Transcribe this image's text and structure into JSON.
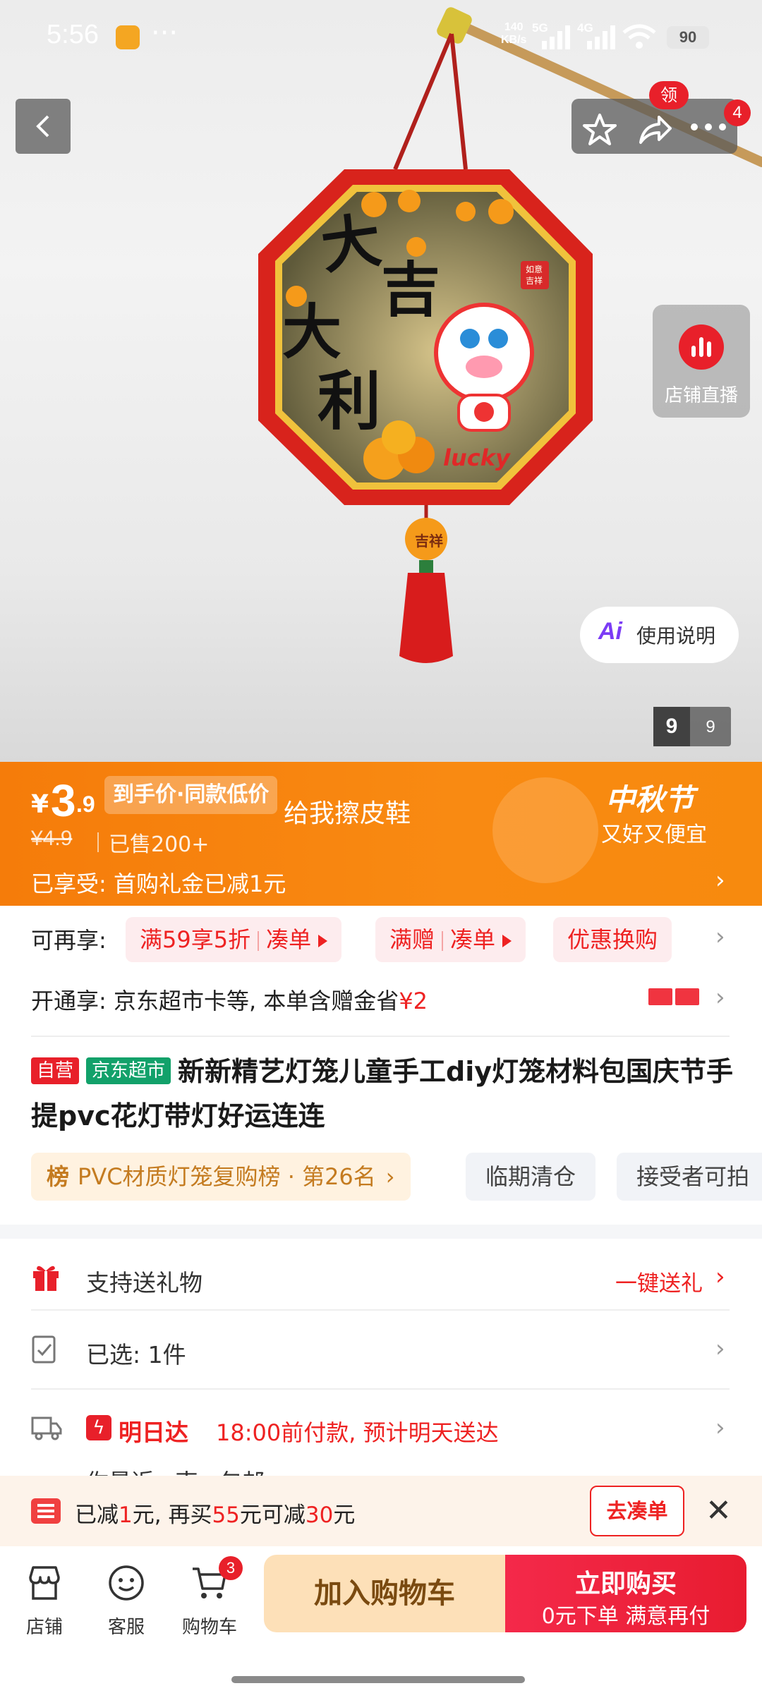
{
  "status_bar": {
    "time": "5:56",
    "more": "···",
    "net_speed_top": "140",
    "net_speed_bottom": "KB/s",
    "signal_1": "5G",
    "signal_2": "4G",
    "battery": "90"
  },
  "top_nav": {
    "coupon_badge": "领",
    "msg_count": "4"
  },
  "product_image": {
    "calligraphy": "大吉大利",
    "charm_text": "吉祥",
    "lucky_text": "lucky",
    "stamp_text": "如意吉祥"
  },
  "side": {
    "live_label": "店铺直播",
    "ai_label": "Ai",
    "guide_label": "使用说明"
  },
  "gallery": {
    "current": "9",
    "total": "9"
  },
  "price": {
    "currency": "¥",
    "integer": "3",
    "decimal": ".9",
    "tag": "到手价·同款低价",
    "overlay_text": "给我擦皮鞋",
    "original": "¥4.9",
    "sold": "已售200+",
    "enjoyed": "已享受: 首购礼金已减1元",
    "festival_title": "中秋节",
    "festival_sub": "又好又便宜"
  },
  "promo": {
    "label": "可再享:",
    "chip1_main": "满59享5折",
    "chip1_action": "凑单",
    "chip2_main": "满赠",
    "chip2_action": "凑单",
    "chip3": "优惠换购"
  },
  "member": {
    "text_prefix": "开通享: 京东超市卡等, 本单含赠金省",
    "amount": "¥2"
  },
  "title": {
    "tag_self": "自营",
    "tag_jd": "京东超市",
    "text": "新新精艺灯笼儿童手工diy灯笼材料包国庆节手提pvc花灯带灯好运连连"
  },
  "rank": {
    "icon": "榜",
    "text": "PVC材质灯笼复购榜 · 第26名",
    "tag2": "临期清仓",
    "tag3": "接受者可拍"
  },
  "services": {
    "gift_label": "支持送礼物",
    "gift_action": "一键送礼",
    "selected_label": "已选: 1件",
    "delivery_badge": "明日达",
    "delivery_text": "18:00前付款, 预计明天送达",
    "partial_text": "你最近 · 南 · 包邮"
  },
  "coupon_bar": {
    "t1": "已减",
    "v1": "1",
    "t2": "元, 再买",
    "v2": "55",
    "t3": "元可减",
    "v3": "30",
    "t4": "元",
    "button": "去凑单"
  },
  "bottom_bar": {
    "shop": "店铺",
    "service": "客服",
    "cart": "购物车",
    "cart_count": "3",
    "add_to_cart": "加入购物车",
    "buy_now": "立即购买",
    "buy_sub": "0元下单 满意再付"
  },
  "colors": {
    "accent_orange": "#f7820e",
    "accent_red": "#e8202a",
    "jd_green": "#12a16a",
    "cart_btn_bg": "#fde0b8"
  }
}
